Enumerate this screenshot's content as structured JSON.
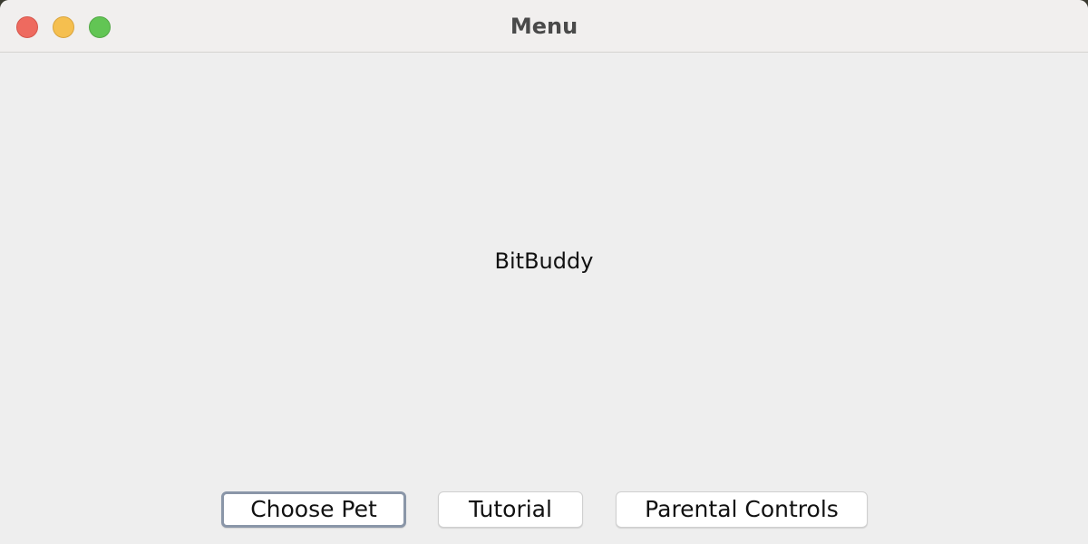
{
  "window": {
    "title": "Menu"
  },
  "main": {
    "app_name": "BitBuddy"
  },
  "buttons": {
    "choose_pet": "Choose Pet",
    "tutorial": "Tutorial",
    "parental_controls": "Parental Controls"
  },
  "colors": {
    "close": "#ee6a5f",
    "minimize": "#f5bf4f",
    "maximize": "#62c554",
    "focus_ring": "#8a96a8"
  }
}
